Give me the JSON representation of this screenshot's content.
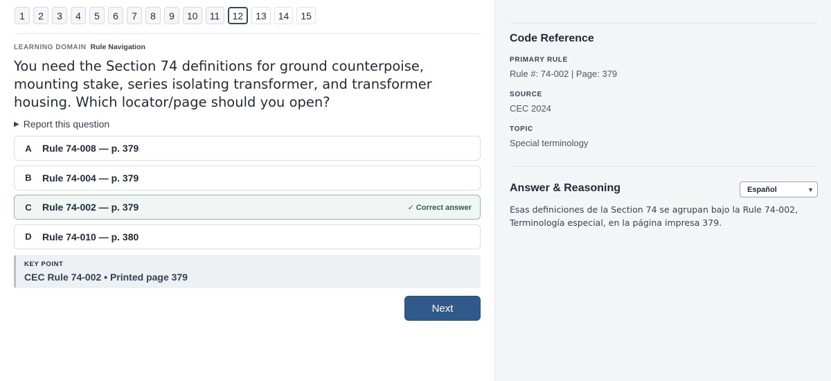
{
  "pager": {
    "pages": [
      "1",
      "2",
      "3",
      "4",
      "5",
      "6",
      "7",
      "8",
      "9",
      "10",
      "11",
      "12",
      "13",
      "14",
      "15"
    ],
    "current": "12"
  },
  "question": {
    "domain_label": "LEARNING DOMAIN",
    "domain_value": "Rule Navigation",
    "text": "You need the Section 74 definitions for ground counterpoise, mounting stake, series isolating transformer, and transformer housing. Which locator/page should you open?",
    "report_label": "Report this question",
    "report_icon": "triangle-right-icon"
  },
  "options": [
    {
      "letter": "A",
      "text": "Rule 74-008 — p. 379"
    },
    {
      "letter": "B",
      "text": "Rule 74-004 — p. 379"
    },
    {
      "letter": "C",
      "text": "Rule 74-002 — p. 379",
      "tag": "✓ Correct answer"
    },
    {
      "letter": "D",
      "text": "Rule 74-010 — p. 380"
    }
  ],
  "key_point": {
    "label": "KEY POINT",
    "text": "CEC Rule 74-002 • Printed page 379"
  },
  "next_label": "Next",
  "reference": {
    "title": "Code Reference",
    "primary_rule_label": "PRIMARY RULE",
    "primary_rule_value": "Rule #: 74-002 | Page: 379",
    "source_label": "SOURCE",
    "source_value": "CEC 2024",
    "topic_label": "TOPIC",
    "topic_value": "Special terminology"
  },
  "answer": {
    "title": "Answer & Reasoning",
    "language": "Español",
    "text": "Esas definiciones de la Section 74 se agrupan bajo la Rule 74-002, Terminología especial, en la página impresa 379."
  },
  "colors": {
    "accent": "#2f5a8a",
    "correct_bg": "#f0f6f4",
    "correct_border": "#8fb5a8",
    "sidebar_bg": "#f4f5f7"
  }
}
